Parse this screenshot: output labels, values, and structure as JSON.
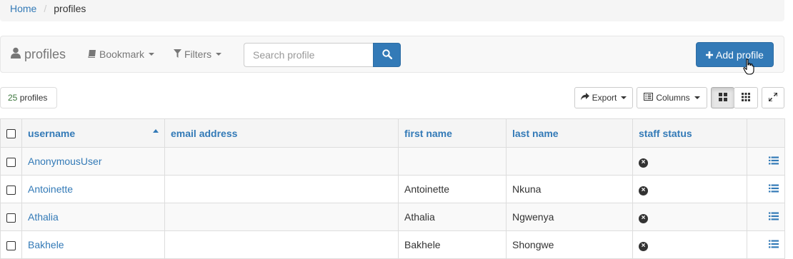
{
  "breadcrumb": {
    "home": "Home",
    "separator": "/",
    "current": "profiles"
  },
  "toolbar": {
    "title": "profiles",
    "bookmark": "Bookmark",
    "filters": "Filters",
    "search_placeholder": "Search profile",
    "add_label": "Add profile"
  },
  "summary": {
    "count": "25",
    "count_label": "profiles"
  },
  "actions": {
    "export": "Export",
    "columns": "Columns"
  },
  "table": {
    "headers": [
      "username",
      "email address",
      "first name",
      "last name",
      "staff status"
    ],
    "sorted_column": "username",
    "rows": [
      {
        "username": "AnonymousUser",
        "email": "",
        "first_name": "",
        "last_name": "",
        "staff": "no"
      },
      {
        "username": "Antoinette",
        "email": "",
        "first_name": "Antoinette",
        "last_name": "Nkuna",
        "staff": "no"
      },
      {
        "username": "Athalia",
        "email": "",
        "first_name": "Athalia",
        "last_name": "Ngwenya",
        "staff": "no"
      },
      {
        "username": "Bakhele",
        "email": "",
        "first_name": "Bakhele",
        "last_name": "Shongwe",
        "staff": "no"
      }
    ]
  },
  "colors": {
    "primary": "#337ab7",
    "count_green": "#3c763d"
  },
  "icons": [
    "user-icon",
    "book-icon",
    "filter-icon",
    "search-icon",
    "plus-icon",
    "share-icon",
    "list-alt-icon",
    "th-large-icon",
    "th-icon",
    "fullscreen-icon",
    "remove-sign-icon",
    "list-icon",
    "hand-cursor-icon"
  ]
}
